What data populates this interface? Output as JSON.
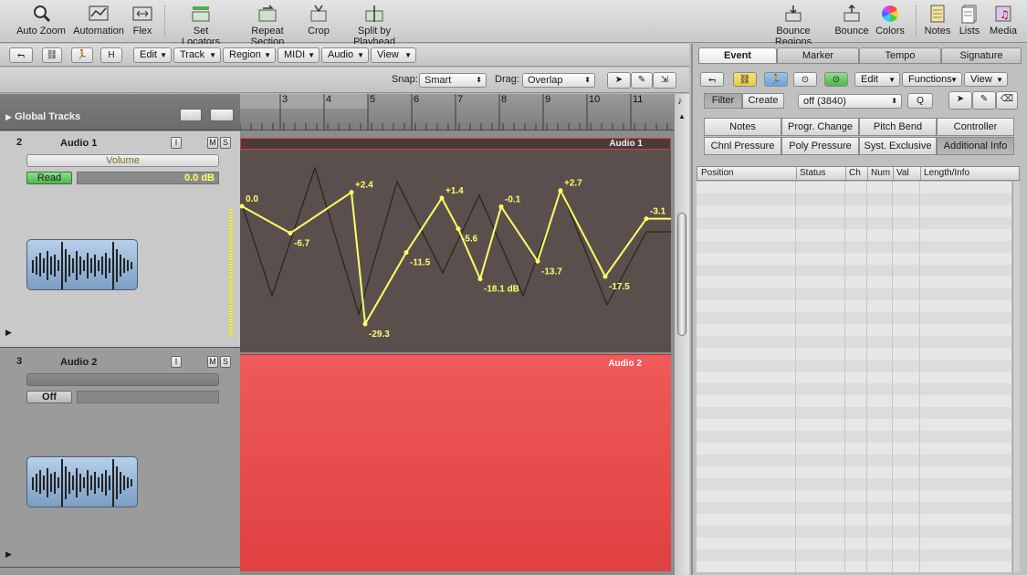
{
  "toolbar": {
    "auto_zoom": "Auto Zoom",
    "automation": "Automation",
    "flex": "Flex",
    "set_locators": "Set Locators",
    "repeat_section": "Repeat Section",
    "crop": "Crop",
    "split_by_playhead": "Split by Playhead",
    "bounce_regions": "Bounce Regions",
    "bounce": "Bounce",
    "colors": "Colors",
    "notes": "Notes",
    "lists": "Lists",
    "media": "Media"
  },
  "editbar": {
    "h": "H",
    "edit": "Edit",
    "track": "Track",
    "region": "Region",
    "midi": "MIDI",
    "audio": "Audio",
    "view": "View"
  },
  "snapbar": {
    "snap_label": "Snap:",
    "snap_value": "Smart",
    "drag_label": "Drag:",
    "drag_value": "Overlap"
  },
  "global_tracks": "Global Tracks",
  "tracks": [
    {
      "number": "2",
      "name": "Audio 1",
      "param": "Volume",
      "mode": "Read",
      "value": "0.0 dB",
      "i": "I",
      "m": "M",
      "s": "S"
    },
    {
      "number": "3",
      "name": "Audio 2",
      "param": "",
      "mode": "Off",
      "value": "",
      "i": "I",
      "m": "M",
      "s": "S"
    }
  ],
  "ruler": [
    "3",
    "4",
    "5",
    "6",
    "7",
    "8",
    "9",
    "10",
    "11"
  ],
  "regions": {
    "region1_title": "Audio 1",
    "region2_title": "Audio 2"
  },
  "automation_points": [
    {
      "label": "0.0",
      "v": 0.0
    },
    {
      "label": "-6.7",
      "v": -6.7
    },
    {
      "label": "+2.4",
      "v": 2.4
    },
    {
      "label": "-29.3",
      "v": -29.3
    },
    {
      "label": "-11.5",
      "v": -11.5
    },
    {
      "label": "+1.4",
      "v": 1.4
    },
    {
      "label": "-5.6",
      "v": -5.6
    },
    {
      "label": "-18.1 dB",
      "v": -18.1
    },
    {
      "label": "-0.1",
      "v": -0.1
    },
    {
      "label": "-13.7",
      "v": -13.7
    },
    {
      "label": "+2.7",
      "v": 2.7
    },
    {
      "label": "-17.5",
      "v": -17.5
    },
    {
      "label": "-3.1",
      "v": -3.1
    }
  ],
  "panel": {
    "tabs": [
      "Event",
      "Marker",
      "Tempo",
      "Signature"
    ],
    "edit": "Edit",
    "functions": "Functions",
    "view": "View",
    "filter": "Filter",
    "create": "Create",
    "off_value": "off (3840)",
    "q": "Q",
    "filters_row1": [
      "Notes",
      "Progr. Change",
      "Pitch Bend",
      "Controller"
    ],
    "filters_row2": [
      "Chnl Pressure",
      "Poly Pressure",
      "Syst. Exclusive",
      "Additional Info"
    ],
    "columns": [
      "Position",
      "Status",
      "Ch",
      "Num",
      "Val",
      "Length/Info"
    ]
  },
  "colors": {
    "automation": "#ffff66",
    "region2": "#ee5252",
    "region1": "#5b4f4e"
  }
}
